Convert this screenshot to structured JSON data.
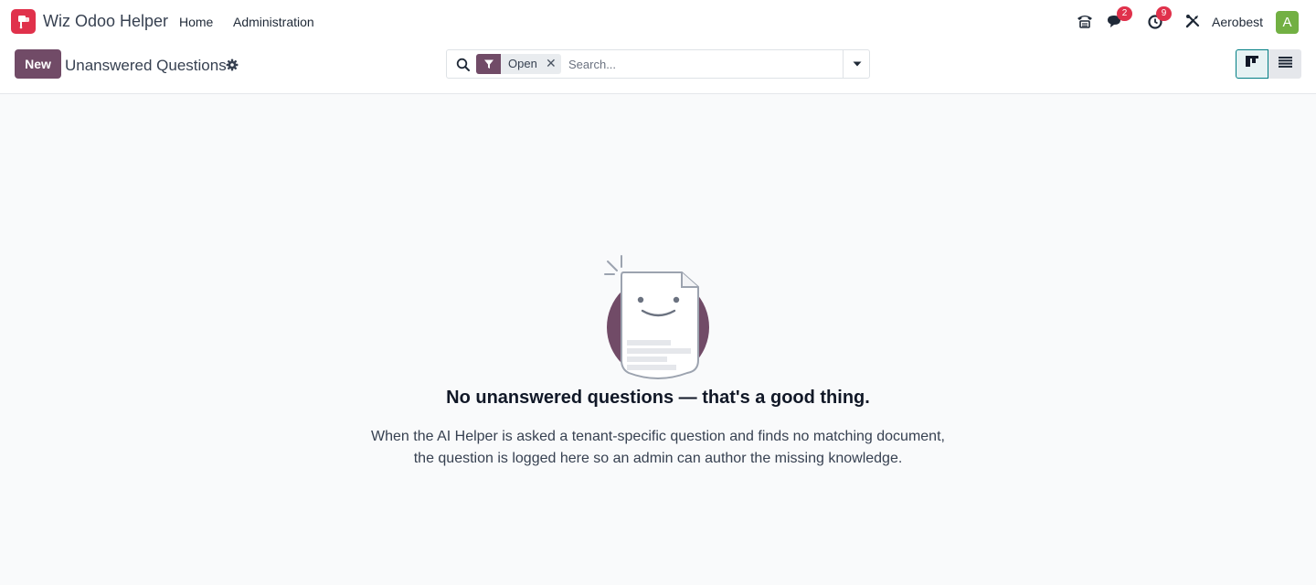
{
  "navbar": {
    "app_name": "Wiz Odoo Helper",
    "menu": [
      {
        "label": "Home"
      },
      {
        "label": "Administration"
      }
    ],
    "systray": {
      "messages_count": "2",
      "activities_count": "9",
      "company": "Aerobest",
      "avatar_initial": "A"
    }
  },
  "control_panel": {
    "new_label": "New",
    "title": "Unanswered Questions",
    "search": {
      "facet_label": "Open",
      "placeholder": "Search..."
    }
  },
  "empty_state": {
    "title": "No unanswered questions — that's a good thing.",
    "help": "When the AI Helper is asked a tenant-specific question and finds no matching document, the question is logged here so an admin can author the missing knowledge."
  },
  "colors": {
    "brand": "#714b67",
    "logo": "#e0314b",
    "badge": "#e0314b",
    "active_view": "#017e84",
    "avatar": "#72b043"
  },
  "icons": [
    "app-logo-icon",
    "phone-icon",
    "chat-icon",
    "clock-icon",
    "tools-icon",
    "gear-icon",
    "search-icon",
    "filter-icon",
    "close-icon",
    "caret-down-icon",
    "kanban-icon",
    "list-icon"
  ]
}
